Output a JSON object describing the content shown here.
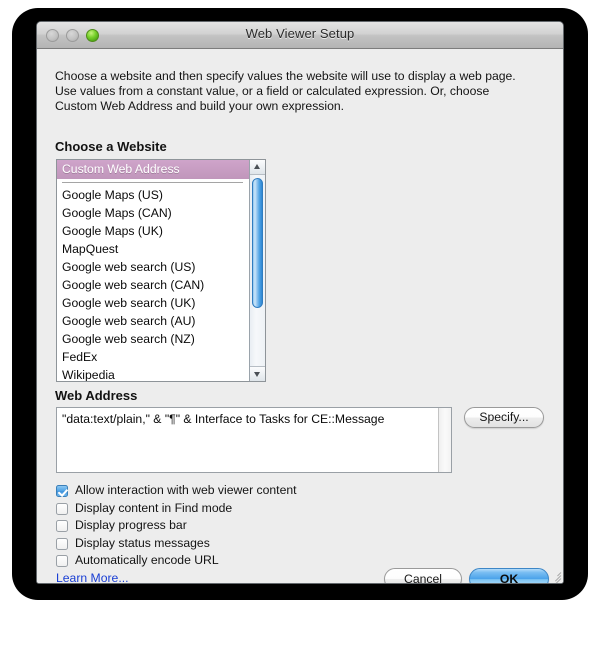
{
  "window": {
    "title": "Web Viewer Setup",
    "traffic_lights": {
      "close": "close-button",
      "minimize": "minimize-button",
      "zoom": "zoom-button"
    }
  },
  "intro": {
    "text": "Choose a website and then specify values the website will use to display a web page. Use values from a constant value, or a field or calculated expression. Or, choose Custom Web Address and build your own expression."
  },
  "choose_website": {
    "label": "Choose a Website",
    "selected": "Custom Web Address",
    "items": [
      "Google Maps (US)",
      "Google Maps (CAN)",
      "Google Maps (UK)",
      "MapQuest",
      "Google web search (US)",
      "Google web search (CAN)",
      "Google web search (UK)",
      "Google web search (AU)",
      "Google web search (NZ)",
      "FedEx",
      "Wikipedia"
    ],
    "highlight_color": "#c096bb",
    "scrollbar_color": "#2f86d2"
  },
  "web_address": {
    "label": "Web Address",
    "value": "\"data:text/plain,\" & \"¶\" & Interface to Tasks for CE::Message",
    "specify_label": "Specify..."
  },
  "options": [
    {
      "label": "Allow interaction with web viewer content",
      "checked": true
    },
    {
      "label": "Display content in Find mode",
      "checked": false
    },
    {
      "label": "Display progress bar",
      "checked": false
    },
    {
      "label": "Display status messages",
      "checked": false
    },
    {
      "label": "Automatically encode URL",
      "checked": false
    }
  ],
  "footer": {
    "learn_more": "Learn More...",
    "cancel": "Cancel",
    "ok": "OK"
  }
}
